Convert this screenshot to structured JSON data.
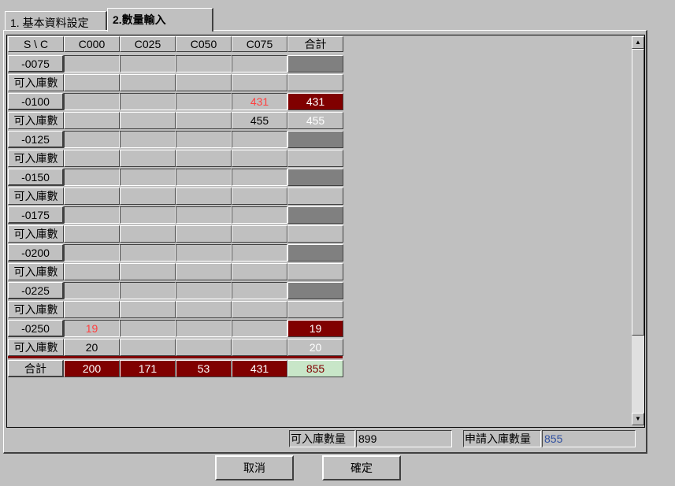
{
  "tabs": {
    "basic": "1. 基本資料設定",
    "qty": "2.數量輸入"
  },
  "table": {
    "corner": "S \\ C",
    "columns": [
      "C000",
      "C025",
      "C050",
      "C075",
      "合計"
    ],
    "available_label": "可入庫數",
    "groups": [
      {
        "size": "-0075",
        "values": [
          "",
          "",
          "",
          ""
        ],
        "total": "",
        "avail": [
          "",
          "",
          "",
          ""
        ],
        "avail_total": ""
      },
      {
        "size": "-0100",
        "values": [
          "",
          "",
          "",
          "431"
        ],
        "total": "431",
        "avail": [
          "",
          "",
          "",
          "455"
        ],
        "avail_total": "455"
      },
      {
        "size": "-0125",
        "values": [
          "",
          "",
          "",
          ""
        ],
        "total": "",
        "avail": [
          "",
          "",
          "",
          ""
        ],
        "avail_total": ""
      },
      {
        "size": "-0150",
        "values": [
          "",
          "",
          "",
          ""
        ],
        "total": "",
        "avail": [
          "",
          "",
          "",
          ""
        ],
        "avail_total": ""
      },
      {
        "size": "-0175",
        "values": [
          "",
          "",
          "",
          ""
        ],
        "total": "",
        "avail": [
          "",
          "",
          "",
          ""
        ],
        "avail_total": ""
      },
      {
        "size": "-0200",
        "values": [
          "",
          "",
          "",
          ""
        ],
        "total": "",
        "avail": [
          "",
          "",
          "",
          ""
        ],
        "avail_total": ""
      },
      {
        "size": "-0225",
        "values": [
          "",
          "",
          "",
          ""
        ],
        "total": "",
        "avail": [
          "",
          "",
          "",
          ""
        ],
        "avail_total": ""
      },
      {
        "size": "-0250",
        "values": [
          "19",
          "",
          "",
          ""
        ],
        "total": "19",
        "avail": [
          "20",
          "",
          "",
          ""
        ],
        "avail_total": "20"
      }
    ],
    "total_row": {
      "label": "合計",
      "values": [
        "200",
        "171",
        "53",
        "431"
      ],
      "grand_total": "855"
    }
  },
  "footer": {
    "available_qty_label": "可入庫數量",
    "available_qty_value": "899",
    "request_qty_label": "申請入庫數量",
    "request_qty_value": "855",
    "request_qty_color": "#3050a0"
  },
  "buttons": {
    "cancel": "取消",
    "confirm": "確定"
  },
  "colors": {
    "filled_cell": "#800000",
    "empty_total": "#808080",
    "grand_total_bg": "#c8e6c8",
    "entered_value_text": "#ff4040"
  },
  "scroll": {
    "position": 0
  }
}
